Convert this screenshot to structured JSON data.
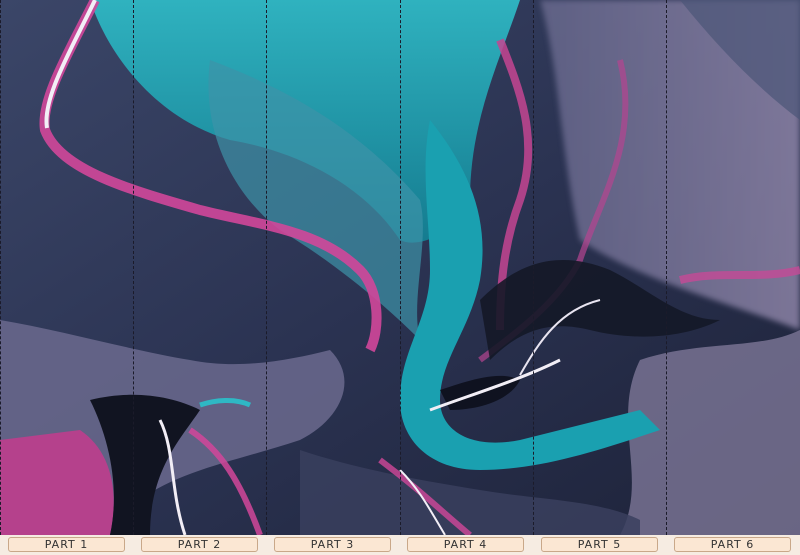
{
  "artwork": {
    "icon": "fluid-marble-art-image",
    "palette": {
      "navy": "#2a3254",
      "teal": "#1aa6b4",
      "magenta": "#d2479a",
      "lavender": "#8c85a8",
      "white_streak": "#f2eef6",
      "deep": "#10131f"
    }
  },
  "panels": [
    {
      "label": "PART 1"
    },
    {
      "label": "PART 2"
    },
    {
      "label": "PART 3"
    },
    {
      "label": "PART 4"
    },
    {
      "label": "PART 5"
    },
    {
      "label": "PART 6"
    }
  ]
}
